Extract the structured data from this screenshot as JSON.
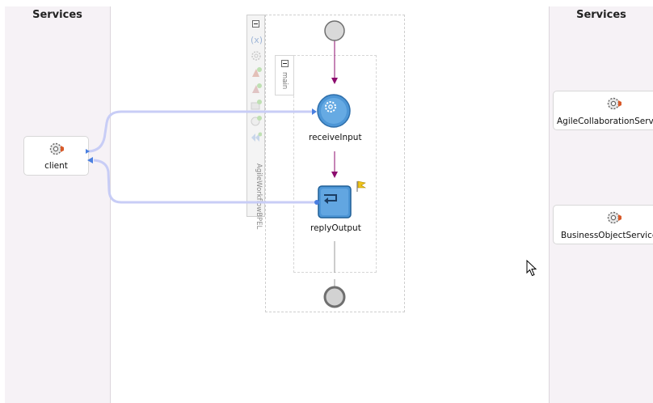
{
  "lanes": {
    "left_title": "Services",
    "right_title": "Services"
  },
  "services": {
    "client": {
      "label": "client",
      "icon": "gear-service-icon"
    },
    "agile": {
      "label": "AgileCollaborationService",
      "icon": "gear-service-icon"
    },
    "bos": {
      "label": "BusinessObjectService",
      "icon": "gear-service-icon"
    }
  },
  "process": {
    "name": "AgileWorkflowBPEL",
    "scope_name": "main",
    "activities": {
      "receive": {
        "label": "receiveInput",
        "icon": "gear-receive-icon"
      },
      "reply": {
        "label": "replyOutput",
        "icon": "reply-icon"
      }
    }
  },
  "colors": {
    "wire": "#c8cdf6",
    "flow_arrow": "#8c0b6e",
    "activity_blue": "#4d96d6",
    "lane_bg": "#f6f2f6"
  }
}
